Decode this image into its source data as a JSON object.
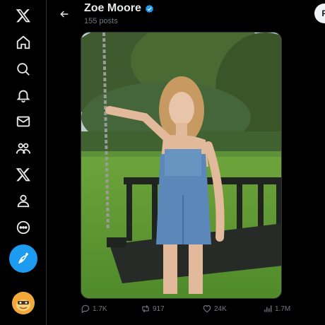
{
  "sidebar": {
    "items": [
      {
        "icon": "x-logo-icon"
      },
      {
        "icon": "home-icon"
      },
      {
        "icon": "search-icon"
      },
      {
        "icon": "bell-icon"
      },
      {
        "icon": "mail-icon"
      },
      {
        "icon": "communities-icon"
      },
      {
        "icon": "x-premium-icon"
      },
      {
        "icon": "profile-icon"
      },
      {
        "icon": "more-icon"
      }
    ],
    "post_icon": "feather-plus-icon"
  },
  "header": {
    "name": "Zoe Moore",
    "posts": "155 posts",
    "follow_label": "Fo"
  },
  "actions": {
    "replies": "1.7K",
    "reposts": "917",
    "likes": "24K",
    "views": "1.7M"
  },
  "colors": {
    "accent": "#1d9bf0",
    "muted": "#71767b",
    "background": "#000000"
  }
}
